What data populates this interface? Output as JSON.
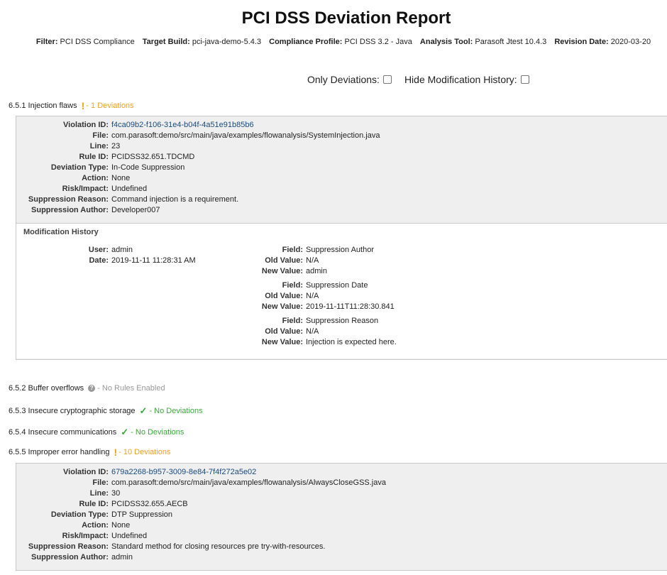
{
  "report": {
    "title": "PCI DSS Deviation Report",
    "filters": [
      {
        "label": "Filter:",
        "value": "PCI DSS Compliance"
      },
      {
        "label": "Target Build:",
        "value": "pci-java-demo-5.4.3"
      },
      {
        "label": "Compliance Profile:",
        "value": "PCI DSS 3.2 - Java"
      },
      {
        "label": "Analysis Tool:",
        "value": "Parasoft Jtest 10.4.3"
      },
      {
        "label": "Revision Date:",
        "value": "2020-03-20"
      }
    ],
    "toggles": {
      "only_deviations": "Only Deviations:",
      "hide_modification_history": "Hide Modification History:"
    }
  },
  "sections": [
    {
      "name": "6.5.1 Injection flaws",
      "status": "- 1 Deviations",
      "status_type": "warning",
      "icon": "exclamation-icon"
    },
    {
      "name": "6.5.2 Buffer overflows",
      "status": "- No Rules Enabled",
      "status_type": "na",
      "icon": "question-icon"
    },
    {
      "name": "6.5.3 Insecure cryptographic storage",
      "status": "- No Deviations",
      "status_type": "ok",
      "icon": "checkmark-icon"
    },
    {
      "name": "6.5.4 Insecure communications",
      "status": "- No Deviations",
      "status_type": "ok",
      "icon": "checkmark-icon"
    },
    {
      "name": "6.5.5 Improper error handling",
      "status": "- 10 Deviations",
      "status_type": "warning",
      "icon": "exclamation-icon"
    }
  ],
  "field_labels": {
    "violation_id": "Violation ID:",
    "file": "File:",
    "line": "Line:",
    "rule_id": "Rule ID:",
    "deviation_type": "Deviation Type:",
    "action": "Action:",
    "risk_impact": "Risk/Impact:",
    "suppression_reason": "Suppression Reason:",
    "suppression_author": "Suppression Author:",
    "modification_history": "Modification History",
    "user": "User:",
    "date": "Date:",
    "field": "Field:",
    "old_value": "Old Value:",
    "new_value": "New Value:"
  },
  "violations": [
    {
      "violation_id": "f4ca09b2-f106-31e4-b04f-4a51e91b85b6",
      "file": "com.parasoft:demo/src/main/java/examples/flowanalysis/SystemInjection.java",
      "line": "23",
      "rule_id": "PCIDSS32.651.TDCMD",
      "deviation_type": "In-Code Suppression",
      "action": "None",
      "risk_impact": "Undefined",
      "suppression_reason": "Command injection is a requirement.",
      "suppression_author": "Developer007",
      "history": {
        "user": "admin",
        "date": "2019-11-11 11:28:31 AM",
        "changes": [
          {
            "field": "Suppression Author",
            "old_value": "N/A",
            "new_value": "admin"
          },
          {
            "field": "Suppression Date",
            "old_value": "N/A",
            "new_value": "2019-11-11T11:28:30.841"
          },
          {
            "field": "Suppression Reason",
            "old_value": "N/A",
            "new_value": "Injection is expected here."
          }
        ]
      }
    },
    {
      "violation_id": "679a2268-b957-3009-8e84-7f4f272a5e02",
      "file": "com.parasoft:demo/src/main/java/examples/flowanalysis/AlwaysCloseGSS.java",
      "line": "30",
      "rule_id": "PCIDSS32.655.AECB",
      "deviation_type": "DTP Suppression",
      "action": "None",
      "risk_impact": "Undefined",
      "suppression_reason": "Standard method for closing resources pre try-with-resources.",
      "suppression_author": "admin"
    }
  ]
}
